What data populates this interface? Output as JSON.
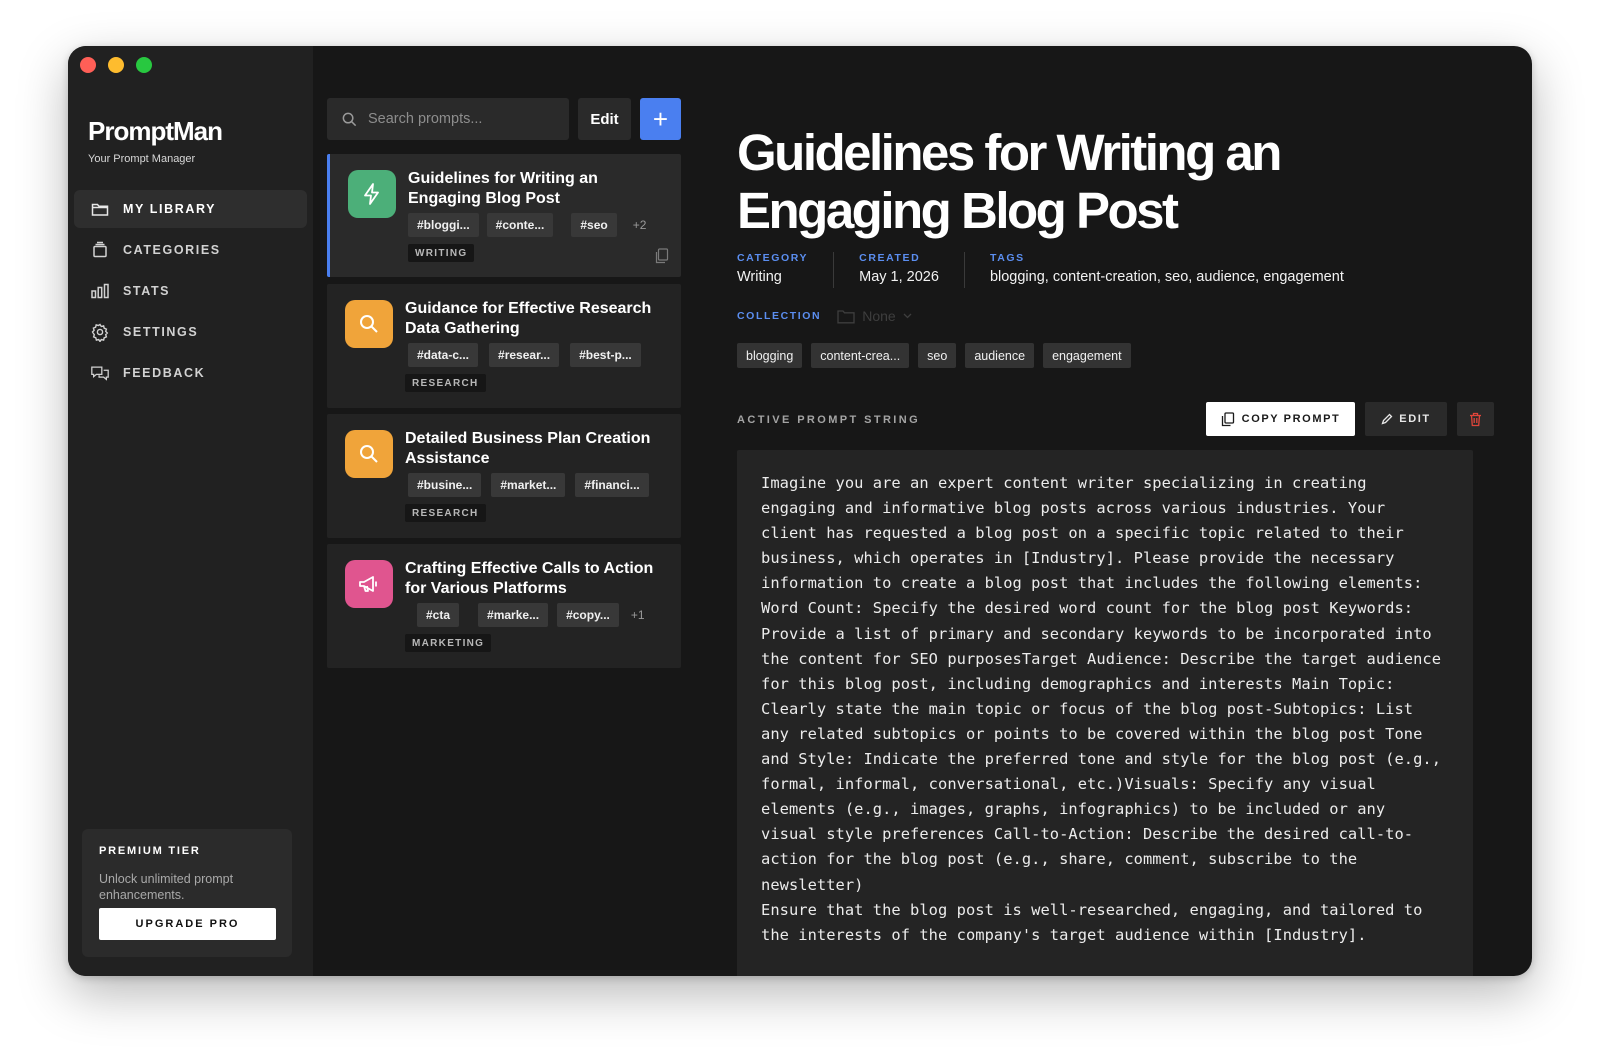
{
  "app": {
    "name": "PromptMan",
    "tagline": "Your Prompt Manager"
  },
  "sidebar": {
    "items": [
      {
        "label": "MY LIBRARY",
        "icon": "folder-icon",
        "active": true
      },
      {
        "label": "CATEGORIES",
        "icon": "layers-icon",
        "active": false
      },
      {
        "label": "STATS",
        "icon": "bar-chart-icon",
        "active": false
      },
      {
        "label": "SETTINGS",
        "icon": "gear-icon",
        "active": false
      },
      {
        "label": "FEEDBACK",
        "icon": "chat-icon",
        "active": false
      }
    ],
    "premium": {
      "title": "PREMIUM TIER",
      "description": "Unlock unlimited prompt enhancements.",
      "button": "UPGRADE PRO"
    }
  },
  "toolbar": {
    "search_placeholder": "Search prompts...",
    "edit_label": "Edit",
    "add_label": "+"
  },
  "prompts": [
    {
      "title": "Guidelines for Writing an Engaging Blog Post",
      "icon": "lightning-icon",
      "icon_color": "#4caf79",
      "tags": [
        "#bloggi...",
        "#conte...",
        "#seo"
      ],
      "more": "+2",
      "category": "WRITING",
      "selected": true
    },
    {
      "title": "Guidance for Effective Research Data Gathering",
      "icon": "search-icon",
      "icon_color": "#f0a43a",
      "tags": [
        "#data-c...",
        "#resear...",
        "#best-p..."
      ],
      "more": "",
      "category": "RESEARCH",
      "selected": false
    },
    {
      "title": "Detailed Business Plan Creation Assistance",
      "icon": "search-icon",
      "icon_color": "#f0a43a",
      "tags": [
        "#busine...",
        "#market...",
        "#financi..."
      ],
      "more": "",
      "category": "RESEARCH",
      "selected": false
    },
    {
      "title": "Crafting Effective Calls to Action for Various Platforms",
      "icon": "megaphone-icon",
      "icon_color": "#e0558f",
      "tags": [
        "#cta",
        "#marke...",
        "#copy..."
      ],
      "more": "+1",
      "category": "MARKETING",
      "selected": false
    }
  ],
  "detail": {
    "title": "Guidelines for Writing an Engaging Blog Post",
    "category_label": "CATEGORY",
    "category": "Writing",
    "created_label": "CREATED",
    "created": "May 1, 2026",
    "tags_label": "TAGS",
    "tags_text": "blogging, content-creation, seo, audience, engagement",
    "collection_label": "COLLECTION",
    "collection_value": "None",
    "tags": [
      "blogging",
      "content-crea...",
      "seo",
      "audience",
      "engagement"
    ],
    "active_label": "ACTIVE PROMPT STRING",
    "copy_label": "COPY PROMPT",
    "edit_label": "EDIT",
    "prompt": "Imagine you are an expert content writer specializing in creating engaging and informative blog posts across various industries. Your client has requested a blog post on a specific topic related to their business, which operates in [Industry]. Please provide the necessary information to create a blog post that includes the following elements: Word Count: Specify the desired word count for the blog post Keywords: Provide a list of primary and secondary keywords to be incorporated into the content for SEO purposesTarget Audience: Describe the target audience for this blog post, including demographics and interests Main Topic: Clearly state the main topic or focus of the blog post-Subtopics: List any related subtopics or points to be covered within the blog post Tone and Style: Indicate the preferred tone and style for the blog post (e.g., formal, informal, conversational, etc.)Visuals: Specify any visual elements (e.g., images, graphs, infographics) to be included or any visual style preferences Call-to-Action: Describe the desired call-to-action for the blog post (e.g., share, comment, subscribe to the newsletter)\nEnsure that the blog post is well-researched, engaging, and tailored to the interests of the company's target audience within [Industry]."
  },
  "colors": {
    "accent": "#4a7ff0",
    "window_bg": "#171717",
    "sidebar_bg": "#212121",
    "danger": "#e0453a"
  }
}
